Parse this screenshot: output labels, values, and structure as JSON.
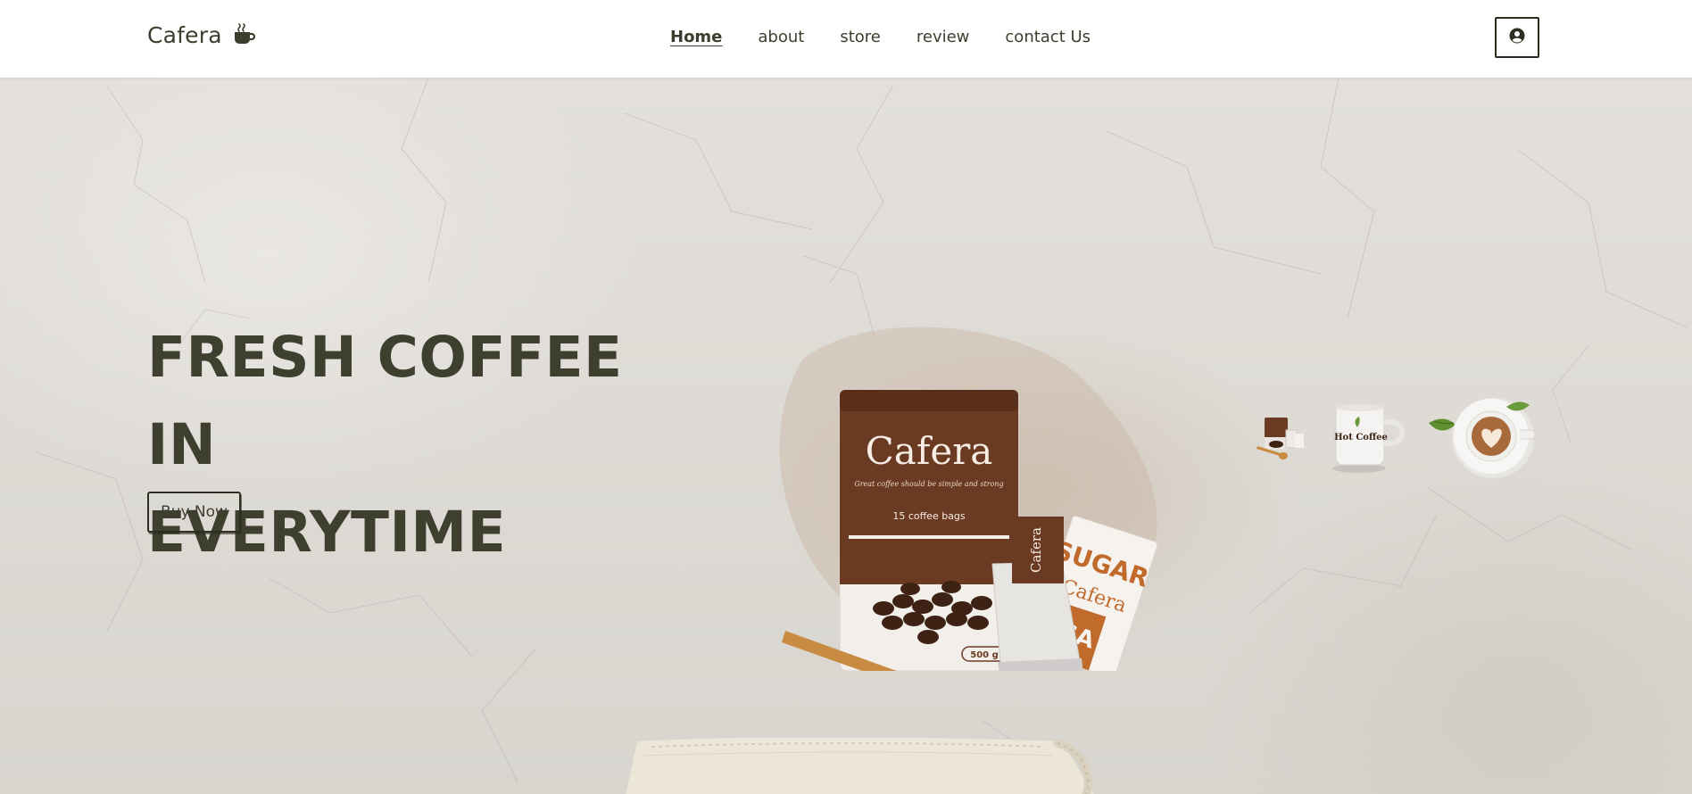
{
  "brand": {
    "name": "Cafera",
    "icon": "coffee-mug-icon"
  },
  "nav": {
    "items": [
      {
        "label": "Home",
        "active": true
      },
      {
        "label": "about",
        "active": false
      },
      {
        "label": "store",
        "active": false
      },
      {
        "label": "review",
        "active": false
      },
      {
        "label": "contact Us",
        "active": false
      }
    ]
  },
  "header": {
    "user_icon": "user-circle-icon"
  },
  "hero": {
    "title_line1": "FRESH COFFEE IN",
    "title_line2": "EVERYTIME",
    "button_label": "Buy Now"
  },
  "product_image": {
    "pouch_brand": "Cafera",
    "pouch_tagline": "Great coffee should be simple and strong",
    "pouch_count": "15 coffee bags",
    "pouch_weight": "500 g",
    "teabag_label": "Cafera",
    "sugar_label": "SUGAR",
    "sugar_brand": "Cafera",
    "sugar_label_cut": "UGA"
  },
  "thumbnails": [
    {
      "name": "product-set-thumbnail",
      "active": false
    },
    {
      "name": "hot-coffee-mug-thumbnail",
      "active": false,
      "text": "Hot Coffee"
    },
    {
      "name": "latte-cup-thumbnail",
      "active": true
    }
  ],
  "colors": {
    "text_dark": "#3e3f2e",
    "coffee_brown": "#6b3a22",
    "sugar_orange": "#c06a2c",
    "background": "#dcd9d3"
  }
}
